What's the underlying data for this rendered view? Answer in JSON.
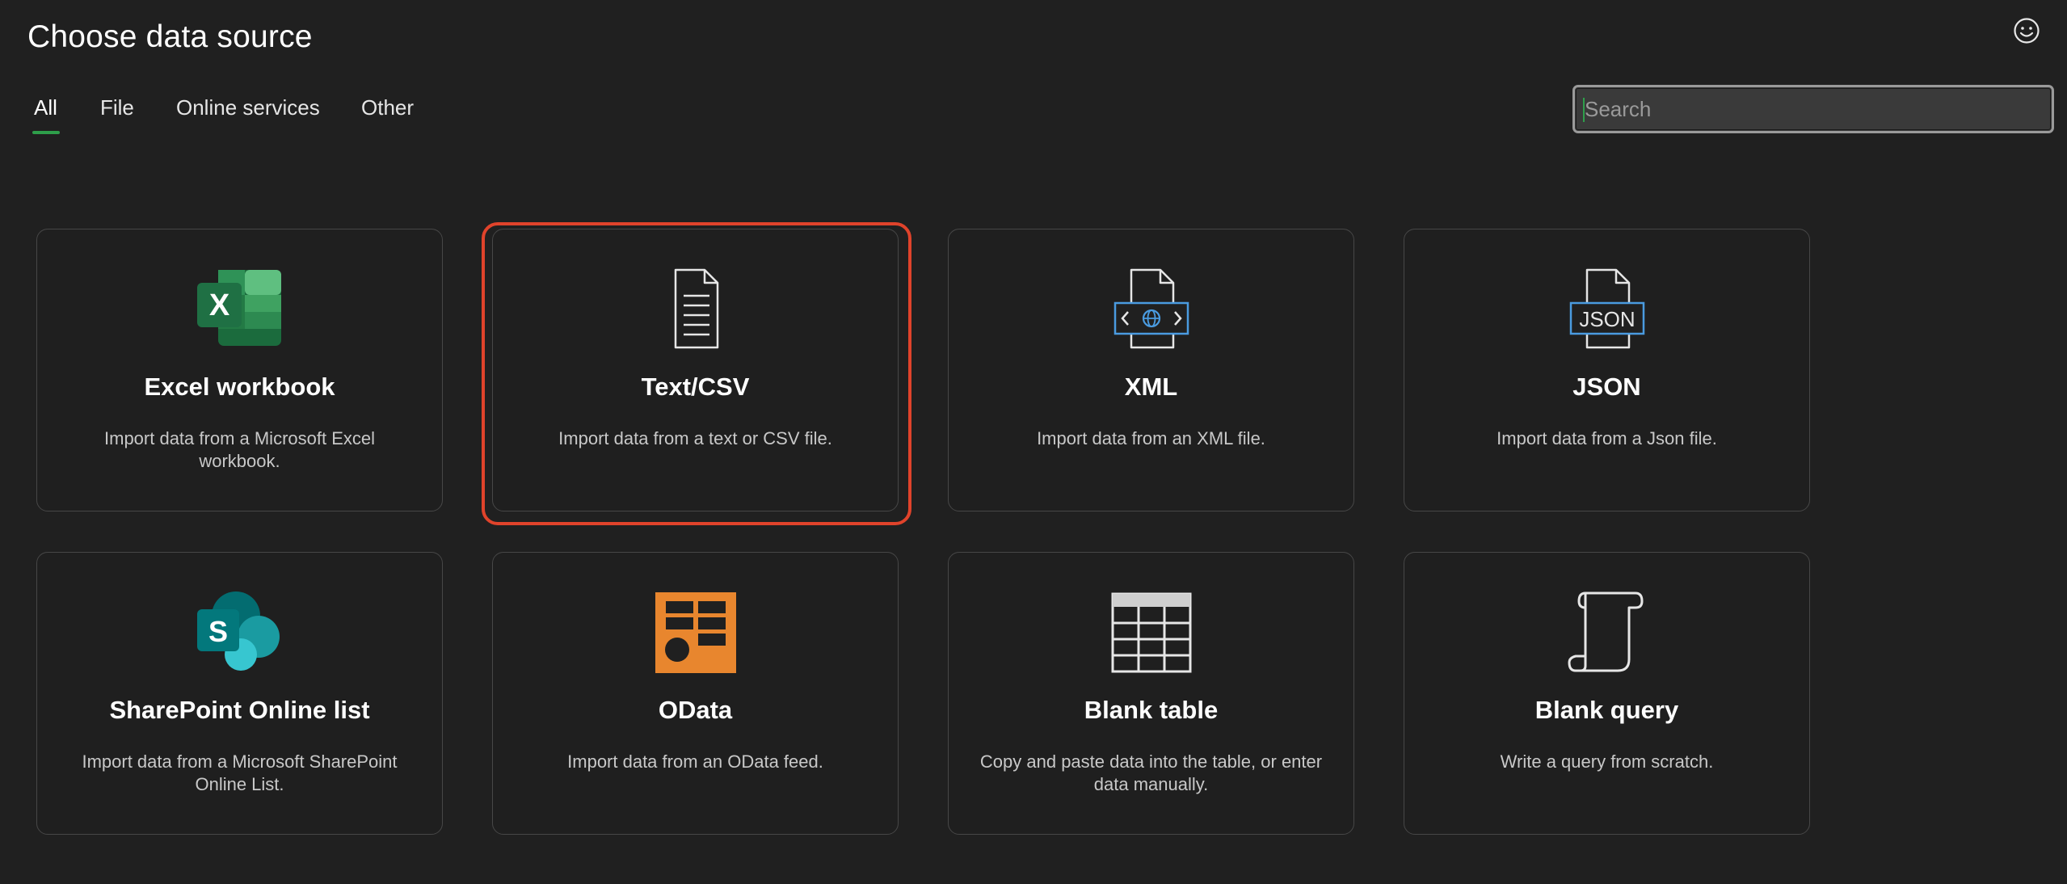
{
  "header": {
    "title": "Choose data source",
    "feedback_icon": "smiley-icon"
  },
  "tabs": [
    {
      "label": "All",
      "active": true
    },
    {
      "label": "File",
      "active": false
    },
    {
      "label": "Online services",
      "active": false
    },
    {
      "label": "Other",
      "active": false
    }
  ],
  "search": {
    "placeholder": "Search",
    "value": ""
  },
  "sources": [
    {
      "name": "Excel workbook",
      "description": "Import data from a Microsoft Excel workbook.",
      "icon": "excel-icon",
      "selected": false
    },
    {
      "name": "Text/CSV",
      "description": "Import data from a text or CSV file.",
      "icon": "text-file-icon",
      "selected": true
    },
    {
      "name": "XML",
      "description": "Import data from an XML file.",
      "icon": "xml-file-icon",
      "selected": false
    },
    {
      "name": "JSON",
      "description": "Import data from a Json file.",
      "icon": "json-file-icon",
      "selected": false
    },
    {
      "name": "SharePoint Online list",
      "description": "Import data from a Microsoft SharePoint Online List.",
      "icon": "sharepoint-icon",
      "selected": false
    },
    {
      "name": "OData",
      "description": "Import data from an OData feed.",
      "icon": "odata-icon",
      "selected": false
    },
    {
      "name": "Blank table",
      "description": "Copy and paste data into the table, or enter data manually.",
      "icon": "blank-table-icon",
      "selected": false
    },
    {
      "name": "Blank query",
      "description": "Write a query from scratch.",
      "icon": "blank-query-icon",
      "selected": false
    }
  ],
  "colors": {
    "accent": "#2e9e4a",
    "selection": "#e0432b",
    "excel_green": "#1f7a45",
    "odata_orange": "#e8862e",
    "xml_blue": "#4a9be0"
  }
}
